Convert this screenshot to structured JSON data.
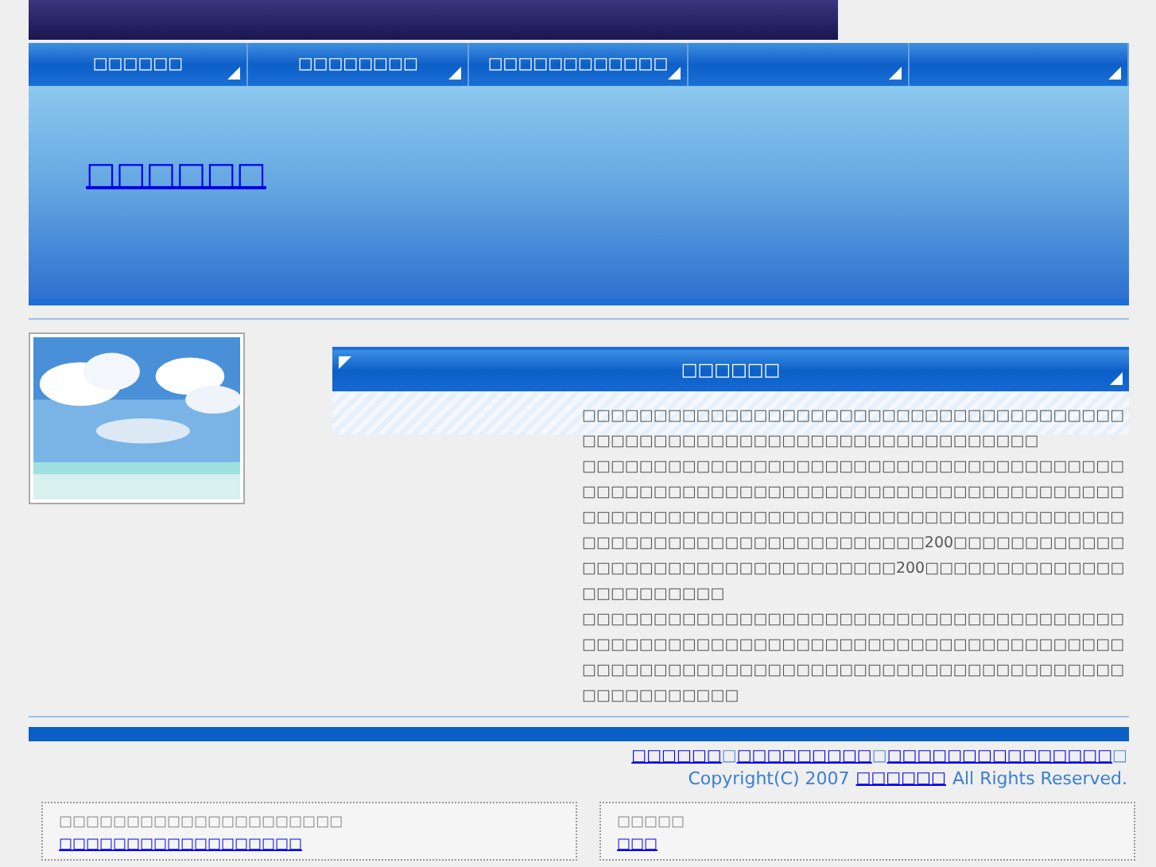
{
  "nav": [
    {
      "kind": "text",
      "label": "□□□□□□"
    },
    {
      "kind": "text",
      "label": "□□□□□□□□"
    },
    {
      "kind": "text",
      "label": "□□□□□□□□□□□□"
    },
    {
      "kind": "blank"
    },
    {
      "kind": "blank"
    }
  ],
  "banner": {
    "title": "□□□□□□"
  },
  "section": {
    "title": "□□□□□□",
    "paragraphs": [
      "□□□□□□□□□□□□□□□□□□□□□□□□□□□□□□□□□□□□□□□□□□□□□□□□□□□□□□□□□□□□□□□□□□□□□□",
      "□□□□□□□□□□□□□□□□□□□□□□□□□□□□□□□□□□□□□□□□□□□□□□□□□□□□□□□□□□□□□□□□□□□□□□□□□□□□□□□□□□□□□□□□□□□□□□□□□□□□□□□□□□□□□□□□□□□□□□□□□□□□□□□□□□□□□□□□□□200□□□□□□□□□□□□□□□□□□□□□□□□□□□□□□□□□□200□□□□□□□□□□□□□□□□□□□□□□□□",
      "□□□□□□□□□□□□□□□□□□□□□□□□□□□□□□□□□□□□□□□□□□□□□□□□□□□□□□□□□□□□□□□□□□□□□□□□□□□□□□□□□□□□□□□□□□□□□□□□□□□□□□□□□□□□□□□□□□□□□□□□□□□□□"
    ]
  },
  "footer": {
    "links": [
      {
        "text": "□□□□□□",
        "kind": "link"
      },
      {
        "text": "□",
        "kind": "separator"
      },
      {
        "text": "□□□□□□□□□",
        "kind": "link"
      },
      {
        "text": "□",
        "kind": "separator"
      },
      {
        "text": "□□□□□□□□□□□□□□□",
        "kind": "link"
      },
      {
        "text": "□",
        "kind": "separator"
      }
    ],
    "copyright_prefix": "Copyright(C) 2007",
    "copyright_link": "□□□□□□",
    "copyright_suffix": "All Rights Reserved."
  },
  "boxes": [
    {
      "label": "□□□□□□□□□□□□□□□□□□□□□",
      "link": "□□□□□□□□□□□□□□□□□□"
    },
    {
      "label": "□□□□□",
      "link": "□□□"
    }
  ]
}
